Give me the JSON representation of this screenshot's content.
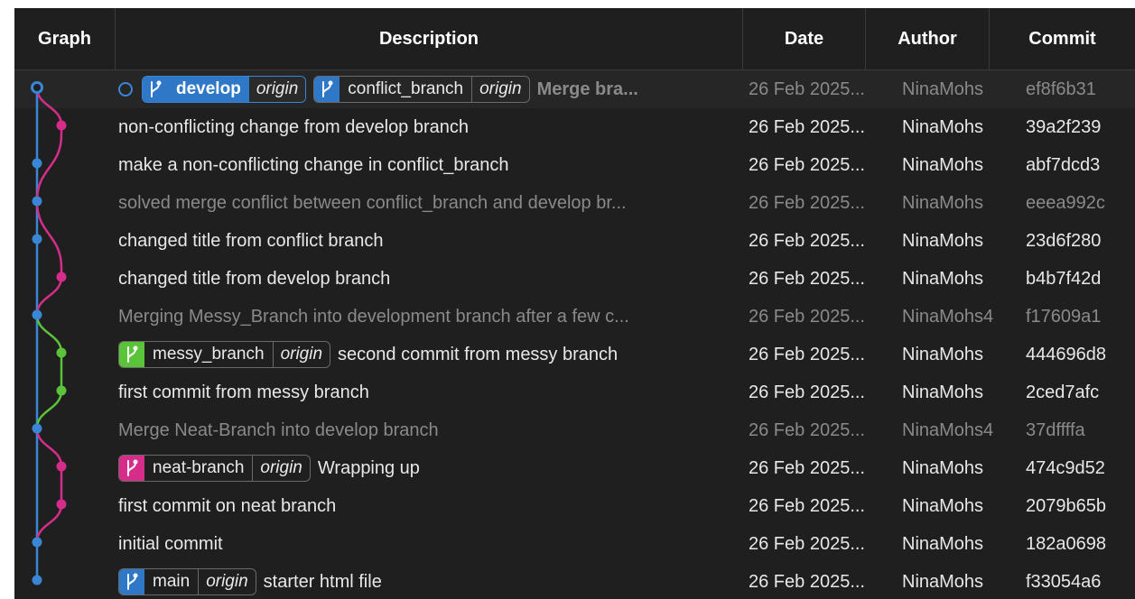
{
  "headers": {
    "graph": "Graph",
    "description": "Description",
    "date": "Date",
    "author": "Author",
    "commit": "Commit"
  },
  "colors": {
    "blue": "#3a86d6",
    "pink": "#d62d8a",
    "green": "#5ac33a",
    "background": "#1f1f1f"
  },
  "rows": [
    {
      "tags": [
        {
          "name": "develop",
          "origin": "origin",
          "color": "#2f78c8",
          "active": true
        },
        {
          "name": "conflict_branch",
          "origin": "origin",
          "color": "#2f78c8"
        }
      ],
      "message": "Merge bra...",
      "date": "26 Feb 2025...",
      "author": "NinaMohs",
      "commit": "ef8f6b31"
    },
    {
      "message": "non-conflicting change from develop branch",
      "date": "26 Feb 2025...",
      "author": "NinaMohs",
      "commit": "39a2f239"
    },
    {
      "message": "make a non-conflicting change in conflict_branch",
      "date": "26 Feb 2025...",
      "author": "NinaMohs",
      "commit": "abf7dcd3"
    },
    {
      "message": "solved merge conflict between conflict_branch and develop br...",
      "date": "26 Feb 2025...",
      "author": "NinaMohs",
      "commit": "eeea992c",
      "dim": true
    },
    {
      "message": "changed title from conflict branch",
      "date": "26 Feb 2025...",
      "author": "NinaMohs",
      "commit": "23d6f280"
    },
    {
      "message": "changed title from develop branch",
      "date": "26 Feb 2025...",
      "author": "NinaMohs",
      "commit": "b4b7f42d"
    },
    {
      "message": "Merging Messy_Branch into development branch after a few c...",
      "date": "26 Feb 2025...",
      "author": "NinaMohs4",
      "commit": "f17609a1",
      "dim": true
    },
    {
      "tags": [
        {
          "name": "messy_branch",
          "origin": "origin",
          "color": "#5ac33a"
        }
      ],
      "message": "second commit from messy branch",
      "date": "26 Feb 2025...",
      "author": "NinaMohs",
      "commit": "444696d8"
    },
    {
      "message": "first commit from messy branch",
      "date": "26 Feb 2025...",
      "author": "NinaMohs",
      "commit": "2ced7afc"
    },
    {
      "message": "Merge Neat-Branch into develop branch",
      "date": "26 Feb 2025...",
      "author": "NinaMohs4",
      "commit": "37dffffa",
      "dim": true
    },
    {
      "tags": [
        {
          "name": "neat-branch",
          "origin": "origin",
          "color": "#d62d8a"
        }
      ],
      "message": "Wrapping up",
      "date": "26 Feb 2025...",
      "author": "NinaMohs",
      "commit": "474c9d52"
    },
    {
      "message": "first commit on neat branch",
      "date": "26 Feb 2025...",
      "author": "NinaMohs",
      "commit": "2079b65b"
    },
    {
      "message": "initial commit",
      "date": "26 Feb 2025...",
      "author": "NinaMohs",
      "commit": "182a0698"
    },
    {
      "tags": [
        {
          "name": "main",
          "origin": "origin",
          "color": "#2f78c8"
        }
      ],
      "message": "starter html file",
      "date": "26 Feb 2025...",
      "author": "NinaMohs",
      "commit": "f33054a6"
    }
  ]
}
